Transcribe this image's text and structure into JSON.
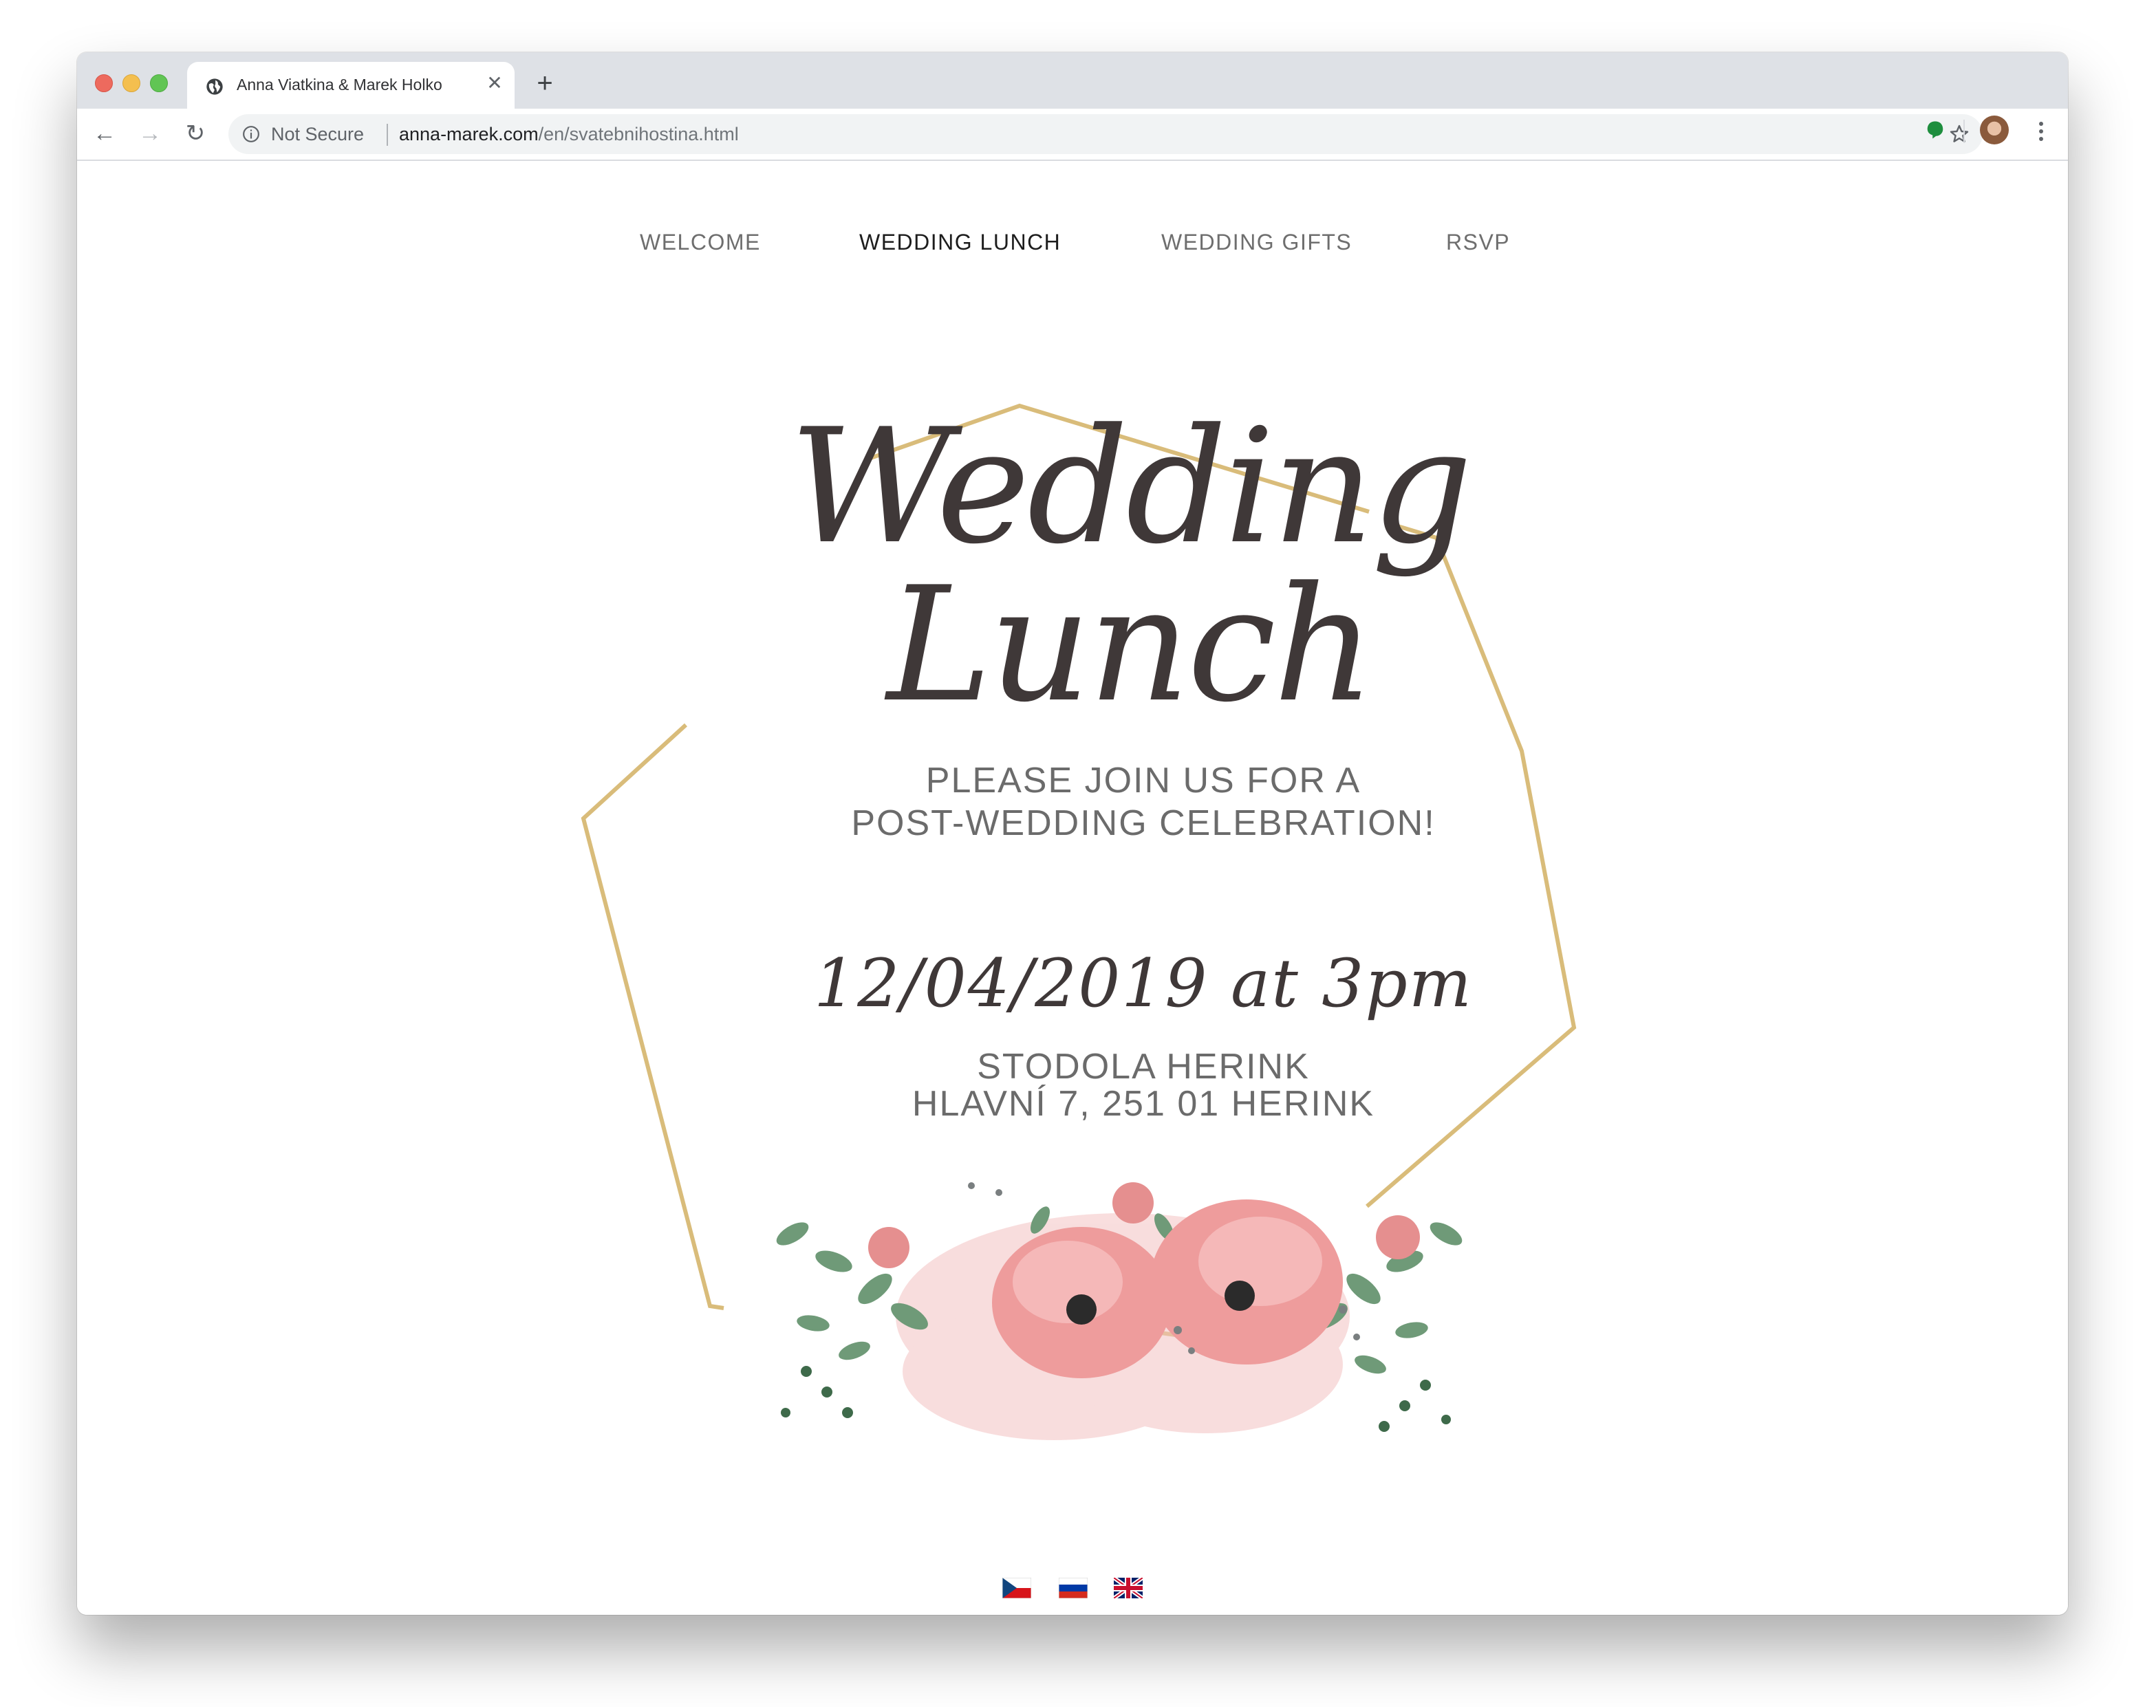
{
  "browser": {
    "tab_title": "Anna Viatkina & Marek Holko",
    "security_label": "Not Secure",
    "url_host": "anna-marek.com",
    "url_path": "/en/svatebnihostina.html"
  },
  "nav": {
    "items": [
      {
        "label": "WELCOME",
        "active": false
      },
      {
        "label": "WEDDING LUNCH",
        "active": true
      },
      {
        "label": "WEDDING GIFTS",
        "active": false
      },
      {
        "label": "RSVP",
        "active": false
      }
    ]
  },
  "hero": {
    "title": "Wedding Lunch",
    "invite_line1": "PLEASE JOIN US FOR A",
    "invite_line2": "POST-WEDDING CELEBRATION!",
    "date": "12/04/2019 at 3pm",
    "venue_line1": "STODOLA HERINK",
    "venue_line2": "HLAVNÍ 7, 251 01 HERINK"
  },
  "languages": [
    "cs",
    "ru",
    "en"
  ],
  "colors": {
    "frame_gold": "#d9bc7a",
    "script_text": "#3f3838",
    "body_text": "#6b6b6b",
    "flower_pink": "#ef9a9a",
    "leaf_green": "#5f8a68"
  }
}
